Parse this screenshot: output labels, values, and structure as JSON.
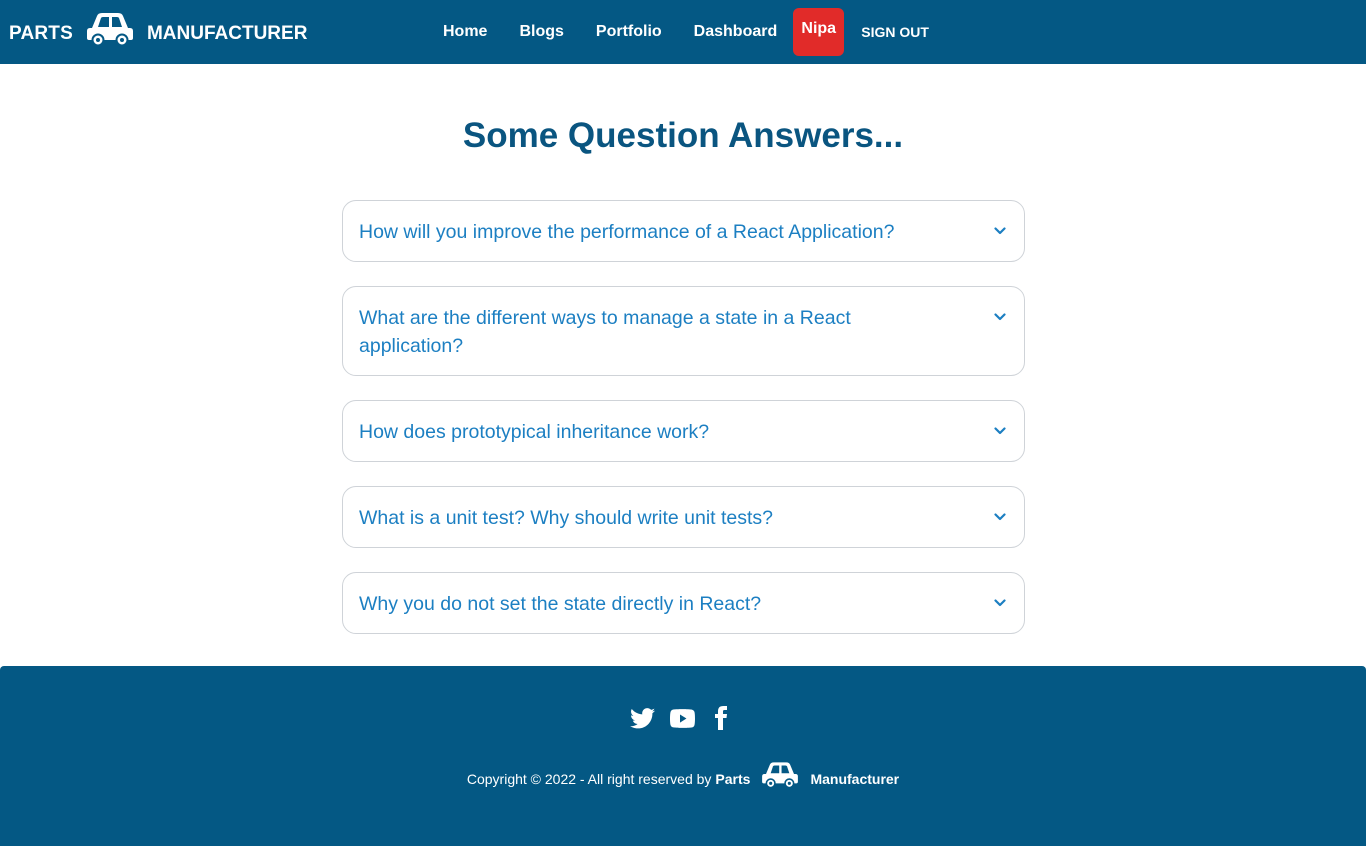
{
  "brand": {
    "part1": "PARTS",
    "part2": "MANUFACTURER"
  },
  "nav": {
    "links": [
      "Home",
      "Blogs",
      "Portfolio",
      "Dashboard"
    ],
    "user": "Nipa",
    "signout": "SIGN OUT"
  },
  "main": {
    "title": "Some Question Answers...",
    "faqs": [
      "How will you improve the performance of a React Application?",
      "What are the different ways to manage a state in a React application?",
      "How does prototypical inheritance work?",
      "What is a unit test? Why should write unit tests?",
      "Why you do not set the state directly in React?"
    ]
  },
  "footer": {
    "social_icons": [
      "twitter-icon",
      "youtube-icon",
      "facebook-icon"
    ],
    "copyright": "Copyright © 2022 - All right reserved by",
    "brand1": "Parts",
    "brand2": "Manufacturer"
  },
  "colors": {
    "primary": "#045884",
    "title": "#0a5580",
    "question": "#1c7fc2",
    "badge": "#e12b29"
  }
}
